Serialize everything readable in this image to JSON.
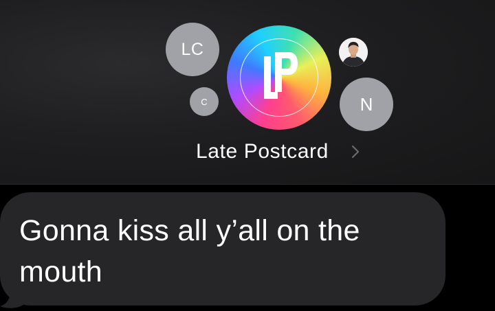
{
  "conversation": {
    "group_name": "Late Postcard",
    "group_avatar_monogram": "LP",
    "members": [
      {
        "initials": "LC"
      },
      {
        "initials": "C"
      },
      {
        "initials": "N"
      },
      {
        "photo": "person-photo"
      }
    ]
  },
  "messages": [
    {
      "direction": "incoming",
      "text": "Gonna kiss all y’all on the mouth"
    }
  ],
  "colors": {
    "header_bg": "#1e1e20",
    "avatar_gray": "#a1a1a8",
    "bubble_incoming": "#262628",
    "background": "#000000",
    "text": "#ffffff",
    "chevron": "#6b6b70"
  }
}
